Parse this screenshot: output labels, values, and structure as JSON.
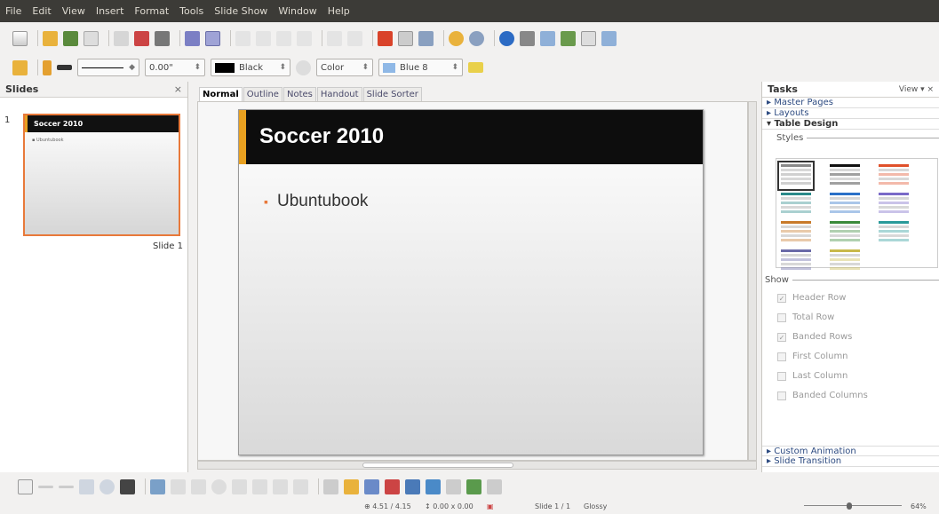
{
  "menu": [
    "File",
    "Edit",
    "View",
    "Insert",
    "Format",
    "Tools",
    "Slide Show",
    "Window",
    "Help"
  ],
  "toolbar_main": [
    "new-doc",
    "open",
    "save",
    "email",
    "edit-file",
    "export-pdf",
    "print",
    "spellcheck",
    "autospell",
    "cut",
    "copy",
    "paste",
    "clone",
    "undo",
    "redo",
    "insert-chart",
    "table",
    "image",
    "draw-functions",
    "navigator",
    "zoom",
    "help",
    "gallery",
    "slide-layout",
    "display-mode",
    "new-slide",
    "show"
  ],
  "line_toolbar": {
    "line_width": "0.00\"",
    "line_color": "Black",
    "area_style": "Color",
    "area_color": "Blue 8",
    "colors": {
      "line": "#000000",
      "area": "#8fb8e6"
    }
  },
  "slides_pane": {
    "title": "Slides",
    "slide_number": "1",
    "slide_label": "Slide 1"
  },
  "view_tabs": [
    {
      "label": "Normal",
      "active": true
    },
    {
      "label": "Outline",
      "active": false
    },
    {
      "label": "Notes",
      "active": false
    },
    {
      "label": "Handout",
      "active": false
    },
    {
      "label": "Slide Sorter",
      "active": false
    }
  ],
  "slide": {
    "title": "Soccer 2010",
    "bullet": "Ubuntubook",
    "accent": "#e8a020",
    "bullet_color": "#e8793a"
  },
  "tasks": {
    "title": "Tasks",
    "view_label": "View",
    "sections": {
      "master_pages": "Master Pages",
      "layouts": "Layouts",
      "table_design": "Table Design",
      "custom_animation": "Custom Animation",
      "slide_transition": "Slide Transition"
    },
    "styles_label": "Styles",
    "show_label": "Show",
    "options": [
      {
        "label": "Header Row",
        "checked": true
      },
      {
        "label": "Total Row",
        "checked": false
      },
      {
        "label": "Banded Rows",
        "checked": true
      },
      {
        "label": "First Column",
        "checked": false
      },
      {
        "label": "Last Column",
        "checked": false
      },
      {
        "label": "Banded Columns",
        "checked": false
      }
    ]
  },
  "status": {
    "position": "4.51 / 4.15",
    "size": "0.00 x 0.00",
    "slide": "Slide 1 / 1",
    "design": "Glossy",
    "zoom": "64%"
  }
}
